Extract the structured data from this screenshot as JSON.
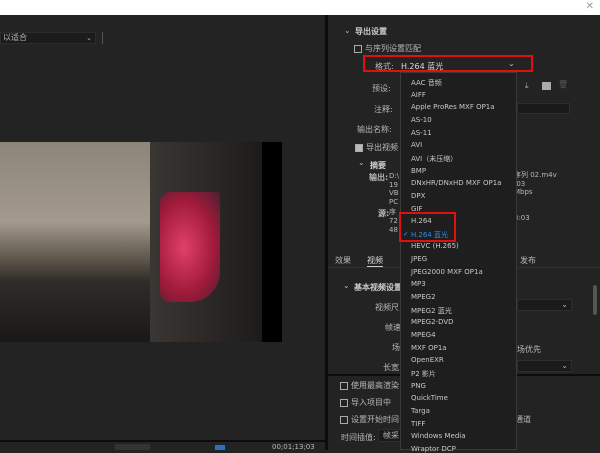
{
  "preview": {
    "fit_label": "以适合",
    "timecode": "00;01;13;03"
  },
  "export_settings": {
    "section_title": "导出设置",
    "match_sequence": "与序列设置匹配",
    "format_label": "格式:",
    "format_value": "H.264 蓝光",
    "preset_label": "预设:",
    "comments_label": "注释:",
    "output_name_label": "输出名称:",
    "export_video": "导出视频",
    "summary_title": "摘要",
    "output_label": "输出:",
    "output_lines": [
      "D:\\",
      "19",
      "VB",
      "PC"
    ],
    "output_right": [
      "序列 02.m4v",
      ":03",
      "Mbps"
    ],
    "source_label": "源:",
    "source_lines": [
      "序",
      "72",
      "48"
    ],
    "source_right": [
      "3:03"
    ]
  },
  "tabs": [
    "效果",
    "视频",
    "发布"
  ],
  "video_settings": {
    "section_title": "基本视频设置",
    "rows": [
      "视频尺",
      "帧速",
      "场",
      "长宽"
    ],
    "field_order_value": "场优先"
  },
  "options": {
    "max_render": "使用最高渲染",
    "import_project": "导入项目中",
    "set_start_time": "设置开始时间",
    "channel": "通道",
    "time_interp_label": "时间插值:",
    "time_interp_value": "帧采"
  },
  "format_options": [
    "AAC 音频",
    "AIFF",
    "Apple ProRes MXF OP1a",
    "AS-10",
    "AS-11",
    "AVI",
    "AVI（未压缩）",
    "BMP",
    "DNxHR/DNxHD MXF OP1a",
    "DPX",
    "GIF",
    "H.264",
    "H.264 蓝光",
    "HEVC (H.265)",
    "JPEG",
    "JPEG2000 MXF OP1a",
    "MP3",
    "MPEG2",
    "MPEG2 蓝光",
    "MPEG2-DVD",
    "MPEG4",
    "MXF OP1a",
    "OpenEXR",
    "P2 影片",
    "PNG",
    "QuickTime",
    "Targa",
    "TIFF",
    "Windows Media",
    "Wraptor DCP"
  ],
  "selected_format": "H.264 蓝光",
  "colors": {
    "highlight": "#e01010",
    "selected": "#2d8ceb"
  }
}
